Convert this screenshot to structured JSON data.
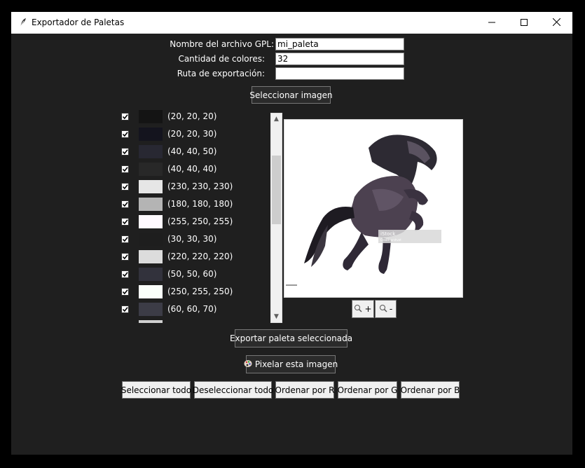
{
  "window": {
    "title": "Exportador de Paletas"
  },
  "form": {
    "gpl_label": "Nombre del archivo GPL:",
    "gpl_value": "mi_paleta",
    "count_label": "Cantidad de colores:",
    "count_value": "32",
    "path_label": "Ruta de exportación:",
    "path_value": ""
  },
  "buttons": {
    "select_image": "Seleccionar imagen",
    "zoom_in": "+",
    "zoom_out": "-",
    "export": "Exportar paleta seleccionada",
    "pixelate": "Pixelar esta imagen",
    "select_all": "Seleccionar todo",
    "deselect_all": "Deseleccionar todo",
    "sort_r": "Ordenar por R",
    "sort_g": "Ordenar por G",
    "sort_b": "Ordenar por B"
  },
  "palette": [
    {
      "label": "(20, 20, 20)",
      "color": "#141414",
      "checked": true
    },
    {
      "label": "(20, 20, 30)",
      "color": "#14141e",
      "checked": true
    },
    {
      "label": "(40, 40, 50)",
      "color": "#282832",
      "checked": true
    },
    {
      "label": "(40, 40, 40)",
      "color": "#282828",
      "checked": true
    },
    {
      "label": "(230, 230, 230)",
      "color": "#e6e6e6",
      "checked": true
    },
    {
      "label": "(180, 180, 180)",
      "color": "#b4b4b4",
      "checked": true
    },
    {
      "label": "(255, 250, 255)",
      "color": "#fffaff",
      "checked": true
    },
    {
      "label": "(30, 30, 30)",
      "color": "#1e1e1e",
      "checked": true
    },
    {
      "label": "(220, 220, 220)",
      "color": "#dcdcdc",
      "checked": true
    },
    {
      "label": "(50, 50, 60)",
      "color": "#32323c",
      "checked": true
    },
    {
      "label": "(250, 255, 250)",
      "color": "#fafffa",
      "checked": true
    },
    {
      "label": "(60, 60, 70)",
      "color": "#3c3c46",
      "checked": true
    },
    {
      "label": "",
      "color": "#d0d0d0",
      "checked": true
    }
  ],
  "image": {
    "watermark": "iStock",
    "watermark_sub": "Credit: arshvet"
  }
}
